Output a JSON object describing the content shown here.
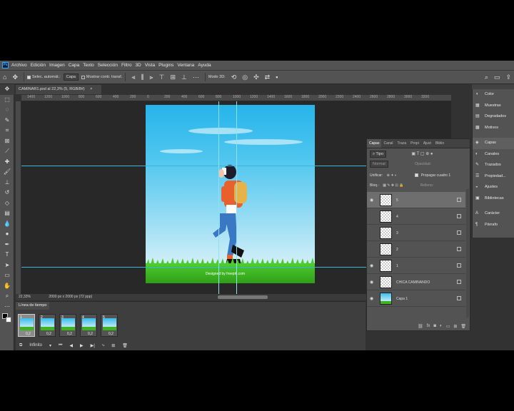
{
  "menu": [
    "Archivo",
    "Edición",
    "Imagen",
    "Capa",
    "Texto",
    "Selección",
    "Filtro",
    "3D",
    "Vista",
    "Plugins",
    "Ventana",
    "Ayuda"
  ],
  "options": {
    "auto_select_label": "Selec. automát.:",
    "auto_select_value": "Capa",
    "transform_label": "Mostrar contr. transf.",
    "mode3d_label": "Modo 3D:"
  },
  "document": {
    "tab_label": "CAMINAR1.psd al 22,3% (5, RGB/8#)",
    "close_glyph": "×",
    "zoom": "22,33%",
    "size_info": "2000 px x 2000 px (72 ppp)",
    "watermark": "Designed by freepik.com"
  },
  "ruler": {
    "ticks": [
      "1400",
      "1200",
      "1000",
      "800",
      "600",
      "400",
      "200",
      "0",
      "200",
      "400",
      "600",
      "800",
      "1000",
      "1200",
      "1400",
      "1600",
      "1800",
      "2000",
      "2200",
      "2400",
      "2600",
      "2800",
      "3000",
      "3200"
    ]
  },
  "timeline": {
    "tab_label": "Línea de tiempo",
    "frames": [
      {
        "num": "1",
        "delay": "0,2"
      },
      {
        "num": "2",
        "delay": "0,2"
      },
      {
        "num": "3",
        "delay": "0,2"
      },
      {
        "num": "4",
        "delay": "0,2"
      },
      {
        "num": "5",
        "delay": "0,2"
      }
    ],
    "loop_value": "Infinito"
  },
  "layers_panel": {
    "tabs": [
      "Capas",
      "Canal",
      "Traza",
      "Propi",
      "Ajust",
      "Biblio"
    ],
    "filter_label": "Tipo",
    "blend_mode": "Normal",
    "opacity_label": "Opacidad:",
    "unify_label": "Unificar:",
    "propagate_label": "Propagar cuadro 1",
    "lock_label": "Bloq.:",
    "fill_label": "Relleno:",
    "layers": [
      {
        "name": "5",
        "visible": true
      },
      {
        "name": "4",
        "visible": false
      },
      {
        "name": "3",
        "visible": false
      },
      {
        "name": "2",
        "visible": false
      },
      {
        "name": "1",
        "visible": true
      },
      {
        "name": "CHICA CAMINANDO",
        "visible": true
      },
      {
        "name": "Capa 1",
        "visible": true
      }
    ]
  },
  "right_panel": [
    {
      "label": "Color",
      "icon": "color-icon"
    },
    {
      "label": "Muestras",
      "icon": "swatches-icon"
    },
    {
      "label": "Degradados",
      "icon": "gradients-icon"
    },
    {
      "label": "Motivos",
      "icon": "patterns-icon"
    },
    {
      "label": "Capas",
      "icon": "layers-icon"
    },
    {
      "label": "Canales",
      "icon": "channels-icon"
    },
    {
      "label": "Trazados",
      "icon": "paths-icon"
    },
    {
      "label": "Propiedad...",
      "icon": "properties-icon"
    },
    {
      "label": "Ajustes",
      "icon": "adjustments-icon"
    },
    {
      "label": "Bibliotecas",
      "icon": "libraries-icon"
    },
    {
      "label": "Carácter",
      "icon": "character-icon"
    },
    {
      "label": "Párrafo",
      "icon": "paragraph-icon"
    }
  ],
  "colors": {
    "panel": "#535353",
    "canvas_bg": "#282828",
    "guide": "#3bb6d6",
    "sky": "#26b4ea",
    "grass": "#3fb422"
  }
}
